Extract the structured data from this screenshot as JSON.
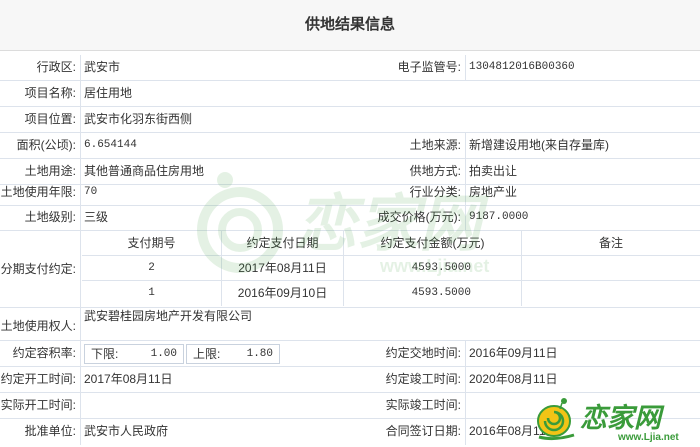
{
  "title": "供地结果信息",
  "fields": {
    "district_label": "行政区:",
    "district_value": "武安市",
    "supervision_label": "电子监管号:",
    "supervision_value": "1304812016B00360",
    "project_name_label": "项目名称:",
    "project_name_value": "居住用地",
    "project_location_label": "项目位置:",
    "project_location_value": "武安市化羽东街西侧",
    "area_label": "面积(公顷):",
    "area_value": "6.654144",
    "land_source_label": "土地来源:",
    "land_source_value": "新增建设用地(来自存量库)",
    "land_use_label": "土地用途:",
    "land_use_value": "其他普通商品住房用地",
    "supply_method_label": "供地方式:",
    "supply_method_value": "拍卖出让",
    "use_years_label": "土地使用年限:",
    "use_years_value": "70",
    "industry_label": "行业分类:",
    "industry_value": "房地产业",
    "land_level_label": "土地级别:",
    "land_level_value": "三级",
    "deal_price_label": "成交价格(万元):",
    "deal_price_value": "9187.0000"
  },
  "installments": {
    "label": "分期支付约定:",
    "headers": [
      "支付期号",
      "约定支付日期",
      "约定支付金额(万元)",
      "备注"
    ],
    "rows": [
      {
        "period": "2",
        "date": "2017年08月11日",
        "amount": "4593.5000",
        "note": ""
      },
      {
        "period": "1",
        "date": "2016年09月10日",
        "amount": "4593.5000",
        "note": ""
      }
    ]
  },
  "holder": {
    "label": "土地使用权人:",
    "value": "武安碧桂园房地产开发有限公司"
  },
  "plot_ratio": {
    "label": "约定容积率:",
    "lower_label": "下限:",
    "lower_value": "1.00",
    "upper_label": "上限:",
    "upper_value": "1.80",
    "delivery_label": "约定交地时间:",
    "delivery_value": "2016年09月11日"
  },
  "schedule": {
    "start_label": "约定开工时间:",
    "start_value": "2017年08月11日",
    "finish_label": "约定竣工时间:",
    "finish_value": "2020年08月11日",
    "actual_start_label": "实际开工时间:",
    "actual_start_value": "",
    "actual_finish_label": "实际竣工时间:",
    "actual_finish_value": ""
  },
  "approval": {
    "unit_label": "批准单位:",
    "unit_value": "武安市人民政府",
    "contract_label": "合同签订日期:",
    "contract_value": "2016年08月11日"
  },
  "branding": {
    "logo_text": "恋家网",
    "logo_url_text": "www.Ljia.net",
    "accent": "#3a9b3a",
    "snail_shell": "#f2c416"
  }
}
